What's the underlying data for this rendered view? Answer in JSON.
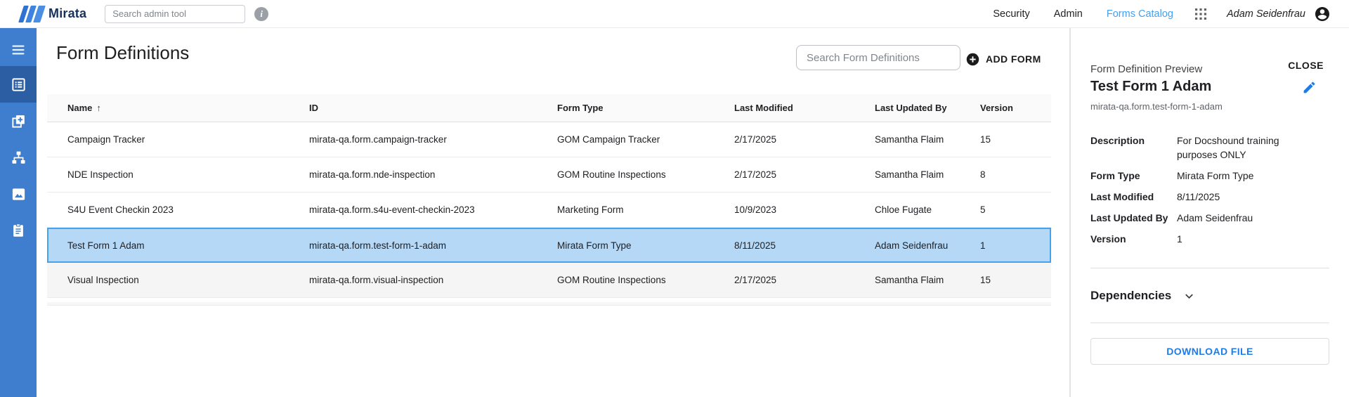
{
  "header": {
    "brand": "Mirata",
    "search": {
      "placeholder": "Search admin tool"
    },
    "nav": {
      "security": "Security",
      "admin": "Admin",
      "forms_catalog": "Forms Catalog"
    },
    "user": {
      "name": "Adam Seidenfrau"
    },
    "icons": [
      "mirata-logo-icon",
      "info-icon",
      "apps-grid-icon",
      "account-circle-icon"
    ]
  },
  "sidebar": {
    "items": [
      {
        "icon": "menu-icon",
        "active": false
      },
      {
        "icon": "form-definitions-icon",
        "active": true
      },
      {
        "icon": "add-library-icon",
        "active": false
      },
      {
        "icon": "workflow-tree-icon",
        "active": false
      },
      {
        "icon": "images-icon",
        "active": false
      },
      {
        "icon": "clipboard-icon",
        "active": false
      }
    ]
  },
  "main": {
    "title": "Form Definitions",
    "search": {
      "placeholder": "Search Form Definitions"
    },
    "add_form": {
      "label": "ADD FORM",
      "icon": "plus-circle-icon"
    },
    "table": {
      "columns": {
        "name": "Name",
        "id": "ID",
        "form_type": "Form Type",
        "last_modified": "Last Modified",
        "last_updated_by": "Last Updated By",
        "version": "Version"
      },
      "sort": {
        "column": "Name",
        "direction": "ascending",
        "arrow": "↑"
      },
      "rows": [
        {
          "name": "Campaign Tracker",
          "id": "mirata-qa.form.campaign-tracker",
          "form_type": "GOM Campaign Tracker",
          "last_modified": "2/17/2025",
          "last_updated_by": "Samantha Flaim",
          "version": "15",
          "state": "default"
        },
        {
          "name": "NDE Inspection",
          "id": "mirata-qa.form.nde-inspection",
          "form_type": "GOM Routine Inspections",
          "last_modified": "2/17/2025",
          "last_updated_by": "Samantha Flaim",
          "version": "8",
          "state": "default"
        },
        {
          "name": "S4U Event Checkin 2023",
          "id": "mirata-qa.form.s4u-event-checkin-2023",
          "form_type": "Marketing Form",
          "last_modified": "10/9/2023",
          "last_updated_by": "Chloe Fugate",
          "version": "5",
          "state": "default"
        },
        {
          "name": "Test Form 1 Adam",
          "id": "mirata-qa.form.test-form-1-adam",
          "form_type": "Mirata Form Type",
          "last_modified": "8/11/2025",
          "last_updated_by": "Adam Seidenfrau",
          "version": "1",
          "state": "selected"
        },
        {
          "name": "Visual Inspection",
          "id": "mirata-qa.form.visual-inspection",
          "form_type": "GOM Routine Inspections",
          "last_modified": "2/17/2025",
          "last_updated_by": "Samantha Flaim",
          "version": "15",
          "state": "hovered"
        }
      ]
    }
  },
  "preview": {
    "title": "Form Definition Preview",
    "close_label": "CLOSE",
    "edit_icon": "pencil-icon",
    "form_name": "Test Form 1 Adam",
    "form_id": "mirata-qa.form.test-form-1-adam",
    "fields": {
      "description": {
        "label": "Description",
        "value": "For Docshound training purposes ONLY"
      },
      "form_type": {
        "label": "Form Type",
        "value": "Mirata Form Type"
      },
      "last_modified": {
        "label": "Last Modified",
        "value": "8/11/2025"
      },
      "last_updated_by": {
        "label": "Last Updated By",
        "value": "Adam Seidenfrau"
      },
      "version": {
        "label": "Version",
        "value": "1"
      }
    },
    "dependencies": {
      "label": "Dependencies",
      "icon": "chevron-down-icon"
    },
    "download": {
      "label": "DOWNLOAD FILE"
    }
  },
  "colors": {
    "sidebar_blue": "#3f7ecf",
    "sidebar_active_blue": "#2b5ea3",
    "selected_row_bg": "#b5d8f6",
    "selected_row_border": "#47a2ec",
    "link_blue": "#42a0f5",
    "action_blue": "#1e7ce8",
    "brand_navy": "#16325c"
  }
}
